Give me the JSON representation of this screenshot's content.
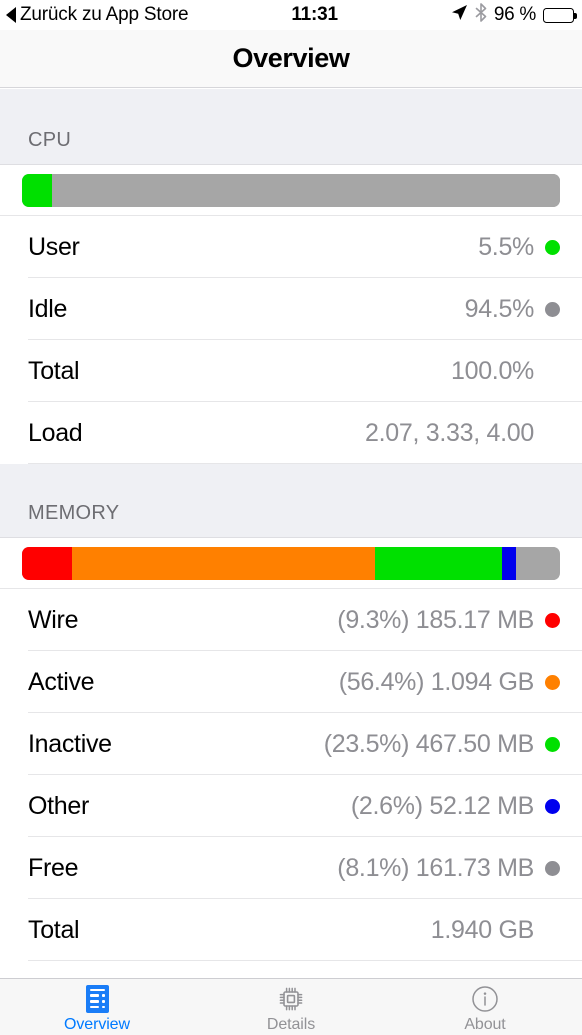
{
  "statusbar": {
    "back_label": "Zurück zu App Store",
    "time": "11:31",
    "battery_text": "96 %",
    "battery_level": 96,
    "location_icon": "location-arrow-icon",
    "bluetooth_icon": "bluetooth-icon",
    "battery_icon": "battery-icon"
  },
  "navbar": {
    "title": "Overview"
  },
  "sections": [
    {
      "header": "CPU",
      "bar": [
        {
          "name": "User",
          "color": "#00e000",
          "percent": 5.5
        },
        {
          "name": "Idle",
          "color": "#a6a6a6",
          "percent": 94.5
        }
      ],
      "rows": [
        {
          "label": "User",
          "value": "5.5%",
          "dot": "#00e000"
        },
        {
          "label": "Idle",
          "value": "94.5%",
          "dot": "#8e8e93"
        },
        {
          "label": "Total",
          "value": "100.0%",
          "dot": null
        },
        {
          "label": "Load",
          "value": "2.07, 3.33, 4.00",
          "dot": null
        }
      ]
    },
    {
      "header": "MEMORY",
      "bar": [
        {
          "name": "Wire",
          "color": "#ff0000",
          "percent": 9.3
        },
        {
          "name": "Active",
          "color": "#ff8000",
          "percent": 56.4
        },
        {
          "name": "Inactive",
          "color": "#00e000",
          "percent": 23.5
        },
        {
          "name": "Other",
          "color": "#0000ee",
          "percent": 2.6
        },
        {
          "name": "Free",
          "color": "#a6a6a6",
          "percent": 8.1
        }
      ],
      "rows": [
        {
          "label": "Wire",
          "value": "(9.3%) 185.17 MB",
          "dot": "#ff0000"
        },
        {
          "label": "Active",
          "value": "(56.4%) 1.094 GB",
          "dot": "#ff8000"
        },
        {
          "label": "Inactive",
          "value": "(23.5%) 467.50 MB",
          "dot": "#00e000"
        },
        {
          "label": "Other",
          "value": "(2.6%) 52.12 MB",
          "dot": "#0000ee"
        },
        {
          "label": "Free",
          "value": "(8.1%) 161.73 MB",
          "dot": "#8e8e93"
        },
        {
          "label": "Total",
          "value": "1.940 GB",
          "dot": null
        }
      ]
    }
  ],
  "tabs": [
    {
      "label": "Overview",
      "icon": "document-list-icon",
      "active": true
    },
    {
      "label": "Details",
      "icon": "cpu-chip-icon",
      "active": false
    },
    {
      "label": "About",
      "icon": "info-circle-icon",
      "active": false
    }
  ],
  "chart_data": {
    "type": "bar",
    "title": "Overview",
    "charts": [
      {
        "name": "CPU",
        "type": "stacked-bar",
        "categories": [
          "User",
          "Idle"
        ],
        "values": [
          5.5,
          94.5
        ],
        "unit": "%",
        "colors": [
          "#00e000",
          "#a6a6a6"
        ],
        "extra": {
          "Total": "100.0%",
          "Load": "2.07, 3.33, 4.00"
        }
      },
      {
        "name": "MEMORY",
        "type": "stacked-bar",
        "categories": [
          "Wire",
          "Active",
          "Inactive",
          "Other",
          "Free"
        ],
        "values": [
          9.3,
          56.4,
          23.5,
          2.6,
          8.1
        ],
        "amounts": [
          "185.17 MB",
          "1.094 GB",
          "467.50 MB",
          "52.12 MB",
          "161.73 MB"
        ],
        "unit": "%",
        "colors": [
          "#ff0000",
          "#ff8000",
          "#00e000",
          "#0000ee",
          "#a6a6a6"
        ],
        "extra": {
          "Total": "1.940 GB"
        }
      }
    ]
  }
}
